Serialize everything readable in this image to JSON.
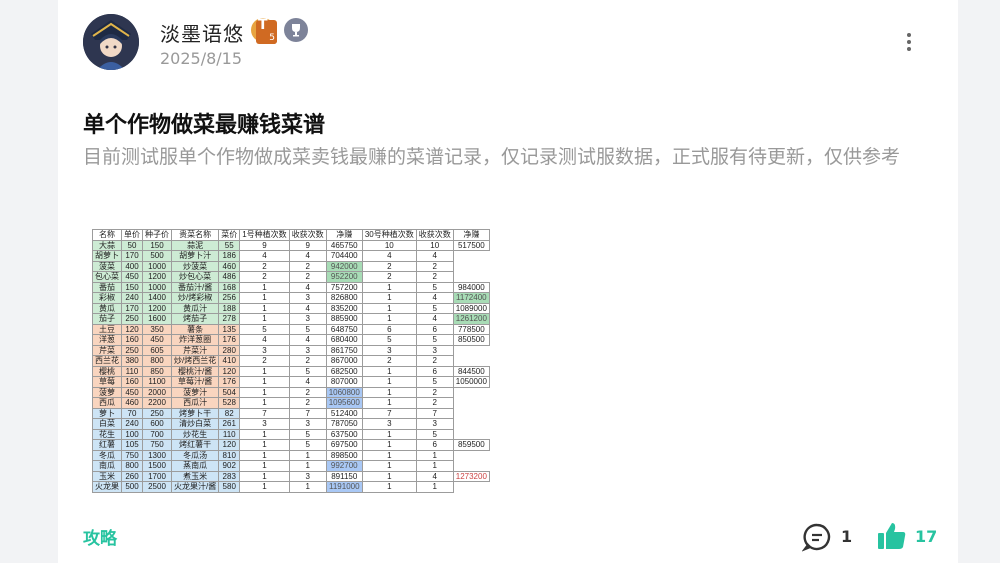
{
  "post": {
    "username": "淡墨语悠",
    "level_badge": "5",
    "level_badge_letter": "T",
    "date": "2025/8/15",
    "title": "单个作物做菜最赚钱菜谱",
    "description": "目前测试服单个作物做成菜卖钱最赚的菜谱记录，仅记录测试服数据，正式服有待更新，仅供参考",
    "tag": "攻略",
    "comment_count": "1",
    "like_count": "17"
  },
  "table": {
    "headers": [
      "名称",
      "单价",
      "种子价",
      "贵菜名称",
      "菜价",
      "1号种植次数",
      "收获次数",
      "净赚",
      "30号种植次数",
      "收获次数",
      "净赚"
    ],
    "rows": [
      {
        "c": [
          "大蒜",
          "50",
          "150",
          "蒜泥",
          "55",
          "9",
          "9",
          "465750",
          "10",
          "10",
          "517500"
        ],
        "color": "g"
      },
      {
        "c": [
          "胡萝卜",
          "170",
          "500",
          "胡萝卜汁",
          "186",
          "4",
          "4",
          "704400",
          "4",
          "4",
          ""
        ],
        "color": "g"
      },
      {
        "c": [
          "菠菜",
          "400",
          "1000",
          "炒菠菜",
          "460",
          "2",
          "2",
          "942000",
          "2",
          "2",
          ""
        ],
        "color": "g",
        "hl7": "hg"
      },
      {
        "c": [
          "包心菜",
          "450",
          "1200",
          "炒包心菜",
          "486",
          "2",
          "2",
          "952200",
          "2",
          "2",
          ""
        ],
        "color": "g",
        "hl7": "hg"
      },
      {
        "c": [
          "番茄",
          "150",
          "1000",
          "番茄汁/酱",
          "168",
          "1",
          "4",
          "757200",
          "1",
          "5",
          "984000"
        ],
        "color": "g"
      },
      {
        "c": [
          "彩椒",
          "240",
          "1400",
          "炒/烤彩椒",
          "256",
          "1",
          "3",
          "826800",
          "1",
          "4",
          "1172400"
        ],
        "color": "g",
        "hl10": "hg"
      },
      {
        "c": [
          "黄瓜",
          "170",
          "1200",
          "黄瓜汁",
          "188",
          "1",
          "4",
          "835200",
          "1",
          "5",
          "1089000"
        ],
        "color": "g"
      },
      {
        "c": [
          "茄子",
          "250",
          "1600",
          "烤茄子",
          "278",
          "1",
          "3",
          "885900",
          "1",
          "4",
          "1261200"
        ],
        "color": "g",
        "hl10": "hg"
      },
      {
        "c": [
          "土豆",
          "120",
          "350",
          "薯条",
          "135",
          "5",
          "5",
          "648750",
          "6",
          "6",
          "778500"
        ],
        "color": "o"
      },
      {
        "c": [
          "洋葱",
          "160",
          "450",
          "炸洋葱圈",
          "176",
          "4",
          "4",
          "680400",
          "5",
          "5",
          "850500"
        ],
        "color": "o"
      },
      {
        "c": [
          "芹菜",
          "250",
          "605",
          "芹菜汁",
          "280",
          "3",
          "3",
          "861750",
          "3",
          "3",
          ""
        ],
        "color": "o"
      },
      {
        "c": [
          "西兰花",
          "380",
          "800",
          "炒/烤西兰花",
          "410",
          "2",
          "2",
          "867000",
          "2",
          "2",
          ""
        ],
        "color": "o"
      },
      {
        "c": [
          "樱桃",
          "110",
          "850",
          "樱桃汁/酱",
          "120",
          "1",
          "5",
          "682500",
          "1",
          "6",
          "844500"
        ],
        "color": "o"
      },
      {
        "c": [
          "草莓",
          "160",
          "1100",
          "草莓汁/酱",
          "176",
          "1",
          "4",
          "807000",
          "1",
          "5",
          "1050000"
        ],
        "color": "o"
      },
      {
        "c": [
          "菠萝",
          "450",
          "2000",
          "菠萝汁",
          "504",
          "1",
          "2",
          "1060800",
          "1",
          "2",
          ""
        ],
        "color": "o",
        "hl7": "hb"
      },
      {
        "c": [
          "西瓜",
          "460",
          "2200",
          "西瓜汁",
          "528",
          "1",
          "2",
          "1095600",
          "1",
          "2",
          ""
        ],
        "color": "o",
        "hl7": "hb"
      },
      {
        "c": [
          "萝卜",
          "70",
          "250",
          "烤萝卜干",
          "82",
          "7",
          "7",
          "512400",
          "7",
          "7",
          ""
        ],
        "color": "b"
      },
      {
        "c": [
          "白菜",
          "240",
          "600",
          "清炒白菜",
          "261",
          "3",
          "3",
          "787050",
          "3",
          "3",
          ""
        ],
        "color": "b"
      },
      {
        "c": [
          "花生",
          "100",
          "700",
          "炒花生",
          "110",
          "1",
          "5",
          "637500",
          "1",
          "5",
          ""
        ],
        "color": "b"
      },
      {
        "c": [
          "红薯",
          "105",
          "750",
          "烤红薯干",
          "120",
          "1",
          "5",
          "697500",
          "1",
          "6",
          "859500"
        ],
        "color": "b"
      },
      {
        "c": [
          "冬瓜",
          "750",
          "1300",
          "冬瓜汤",
          "810",
          "1",
          "1",
          "898500",
          "1",
          "1",
          ""
        ],
        "color": "b"
      },
      {
        "c": [
          "南瓜",
          "800",
          "1500",
          "蒸南瓜",
          "902",
          "1",
          "1",
          "992700",
          "1",
          "1",
          ""
        ],
        "color": "b",
        "hl7": "hb"
      },
      {
        "c": [
          "玉米",
          "260",
          "1700",
          "煮玉米",
          "283",
          "1",
          "3",
          "891150",
          "1",
          "4",
          "1273200"
        ],
        "color": "b",
        "red10": true
      },
      {
        "c": [
          "火龙果",
          "500",
          "2500",
          "火龙果汁/酱",
          "580",
          "1",
          "1",
          "1191000",
          "1",
          "1",
          ""
        ],
        "color": "b",
        "hl7": "hb"
      }
    ]
  },
  "colors": {
    "accent": "#27c3a0",
    "green_row": "#cdebd4",
    "orange_row": "#f9d5bf",
    "blue_row": "#cde4f5"
  },
  "icons": [
    "more-vertical-icon",
    "comment-icon",
    "thumbs-up-icon",
    "trophy-icon"
  ]
}
